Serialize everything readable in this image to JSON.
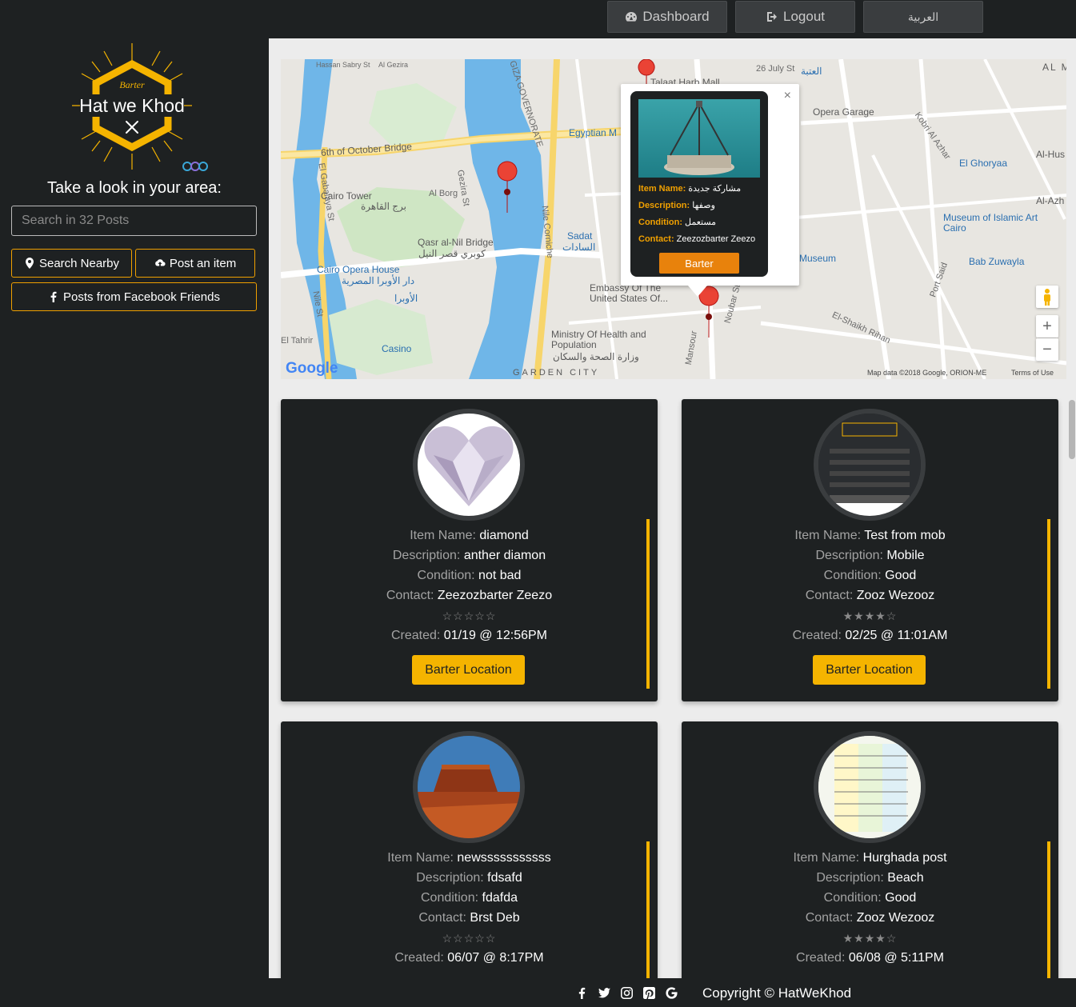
{
  "topbar": {
    "dashboard": "Dashboard",
    "logout": "Logout",
    "language": "العربية"
  },
  "sidebar": {
    "logo": {
      "small": "Barter",
      "main": "Hat we Khod"
    },
    "tagline": "Take a look in your area:",
    "search_placeholder": "Search in 32 Posts",
    "search_nearby": "Search Nearby",
    "post_item": "Post an item",
    "fb_posts": "Posts from Facebook Friends"
  },
  "map": {
    "labels": {
      "bridge": "6th of October Bridge",
      "cairo_tower": "Cairo Tower",
      "cairo_tower_ar": "برج القاهرة",
      "qasr": "Qasr al-Nil Bridge",
      "qasr_ar": "كوبري قصر النيل",
      "opera": "Cairo Opera House",
      "opera_ar": "دار الأوبرا المصرية",
      "opera_station": "الأوبرا",
      "sadat": "Sadat",
      "sadat_ar": "السادات",
      "embassy": "Embassy Of The United States Of...",
      "ministry": "Ministry Of Health and Population",
      "ministry_ar": "وزارة الصحة والسكان",
      "casino": "Casino",
      "garden_city": "GARDEN CITY",
      "opera_garage": "Opera Garage",
      "el_ghoryaa": "El Ghoryaa",
      "museum_islamic": "Museum of Islamic Art Cairo",
      "bab_zuwayla": "Bab Zuwayla",
      "museum": "Museum",
      "egyptian": "Egyptian M",
      "nile_corniche": "Nile Corniche",
      "giza": "GIZA GOVERNORATE",
      "el_shaikh_rihan": "El-Shaikh Rihan",
      "port_said": "Port Said",
      "july26": "26 July St",
      "ataba": "العتبة",
      "talaat_harb": "Talaat Harb Mall",
      "el_gabalaya": "El Gabalaya St",
      "nile_st": "Nile St",
      "gezira": "Gezira St",
      "al_borg": "Al Borg",
      "el_tahrir": "El Tahrir",
      "mansour": "Mansour",
      "nubar": "Noubar St",
      "hassan_sabry": "Hassan Sabry St",
      "al_gezira": "Al Gezira",
      "kobri": "Kobri Al Azhar",
      "al_m": "AL M",
      "al_hus": "Al-Hus",
      "al_azh": "Al-Azh"
    },
    "footer_data": "Map data ©2018 Google, ORION-ME",
    "footer_terms": "Terms of Use",
    "google": "Google",
    "zoom_in": "+",
    "zoom_out": "−"
  },
  "infowindow": {
    "name_label": "Item Name:",
    "name_value": "مشاركة جديدة",
    "desc_label": "Description:",
    "desc_value": "وصفها",
    "cond_label": "Condition:",
    "cond_value": "مستعمل",
    "contact_label": "Contact:",
    "contact_value": "Zeezozbarter Zeezo",
    "button": "Barter",
    "close": "×"
  },
  "labels": {
    "name": "Item Name:",
    "desc": "Description:",
    "cond": "Condition:",
    "contact": "Contact:",
    "created": "Created:",
    "location_btn": "Barter Location"
  },
  "cards": [
    {
      "name": "diamond",
      "desc": "anther diamon",
      "cond": "not bad",
      "contact": "Zeezozbarter Zeezo",
      "stars": "☆☆☆☆☆",
      "created": "01/19 @ 12:56PM"
    },
    {
      "name": "Test from mob",
      "desc": "Mobile",
      "cond": "Good",
      "contact": "Zooz Wezooz",
      "stars": "★★★★☆",
      "created": "02/25 @ 11:01AM"
    },
    {
      "name": "newsssssssssss",
      "desc": "fdsafd",
      "cond": "fdafda",
      "contact": "Brst Deb",
      "stars": "☆☆☆☆☆",
      "created": "06/07 @ 8:17PM"
    },
    {
      "name": "Hurghada post",
      "desc": "Beach",
      "cond": "Good",
      "contact": "Zooz Wezooz",
      "stars": "★★★★☆",
      "created": "06/08 @ 5:11PM"
    }
  ],
  "footer": {
    "copyright": "Copyright © HatWeKhod",
    "icons": [
      "facebook-icon",
      "twitter-icon",
      "instagram-icon",
      "pinterest-icon",
      "google-icon"
    ]
  },
  "colors": {
    "accent": "#f5b400",
    "infobutton": "#e8820c",
    "dark": "#1e2122"
  }
}
